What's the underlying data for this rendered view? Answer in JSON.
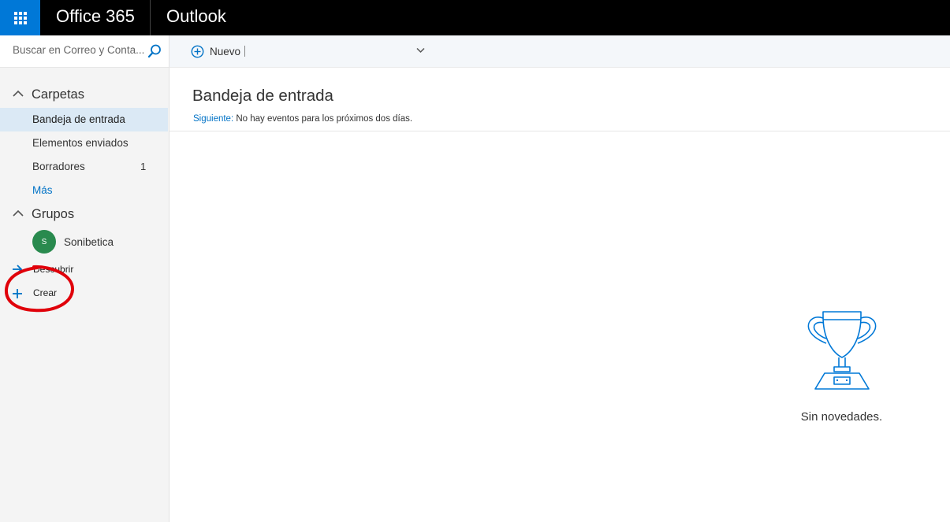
{
  "topbar": {
    "brand": "Office 365",
    "app": "Outlook"
  },
  "search": {
    "placeholder": "Buscar en Correo y Conta..."
  },
  "toolbar": {
    "new_label": "Nuevo"
  },
  "sidebar": {
    "folders_heading": "Carpetas",
    "folders": [
      {
        "label": "Bandeja de entrada",
        "count": ""
      },
      {
        "label": "Elementos enviados",
        "count": ""
      },
      {
        "label": "Borradores",
        "count": "1"
      },
      {
        "label": "Más",
        "count": ""
      }
    ],
    "groups_heading": "Grupos",
    "groups": [
      {
        "initial": "S",
        "label": "Sonibetica"
      }
    ],
    "discover_label": "Descubrir",
    "create_label": "Crear"
  },
  "main": {
    "title": "Bandeja de entrada",
    "next_label": "Siguiente:",
    "next_text": " No hay eventos para los próximos dos días.",
    "empty_text": "Sin novedades."
  },
  "colors": {
    "accent": "#0078d7",
    "link": "#0072c6",
    "selected": "#dbe9f5",
    "annotation": "#e0000a",
    "avatar": "#298a4e"
  }
}
